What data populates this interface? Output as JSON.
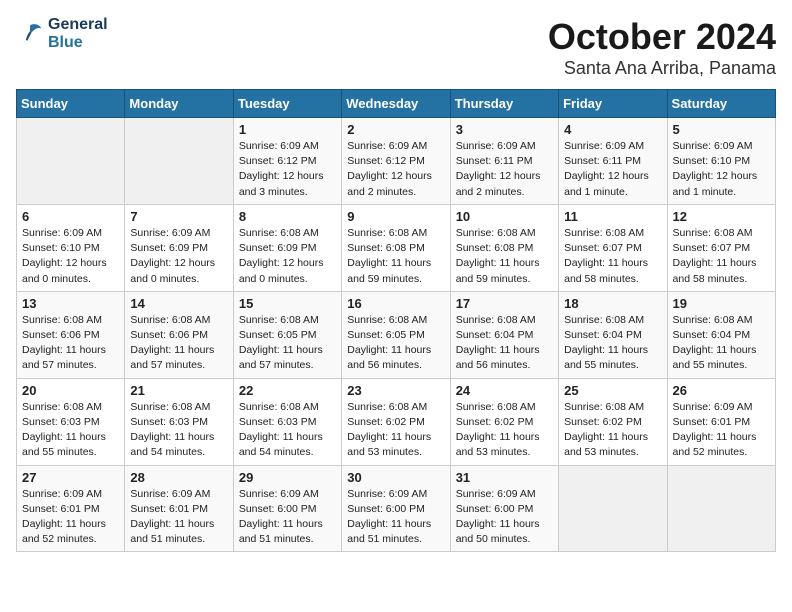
{
  "header": {
    "logo_line1": "General",
    "logo_line2": "Blue",
    "title": "October 2024",
    "subtitle": "Santa Ana Arriba, Panama"
  },
  "weekdays": [
    "Sunday",
    "Monday",
    "Tuesday",
    "Wednesday",
    "Thursday",
    "Friday",
    "Saturday"
  ],
  "weeks": [
    [
      {
        "day": "",
        "info": ""
      },
      {
        "day": "",
        "info": ""
      },
      {
        "day": "1",
        "info": "Sunrise: 6:09 AM\nSunset: 6:12 PM\nDaylight: 12 hours and 3 minutes."
      },
      {
        "day": "2",
        "info": "Sunrise: 6:09 AM\nSunset: 6:12 PM\nDaylight: 12 hours and 2 minutes."
      },
      {
        "day": "3",
        "info": "Sunrise: 6:09 AM\nSunset: 6:11 PM\nDaylight: 12 hours and 2 minutes."
      },
      {
        "day": "4",
        "info": "Sunrise: 6:09 AM\nSunset: 6:11 PM\nDaylight: 12 hours and 1 minute."
      },
      {
        "day": "5",
        "info": "Sunrise: 6:09 AM\nSunset: 6:10 PM\nDaylight: 12 hours and 1 minute."
      }
    ],
    [
      {
        "day": "6",
        "info": "Sunrise: 6:09 AM\nSunset: 6:10 PM\nDaylight: 12 hours and 0 minutes."
      },
      {
        "day": "7",
        "info": "Sunrise: 6:09 AM\nSunset: 6:09 PM\nDaylight: 12 hours and 0 minutes."
      },
      {
        "day": "8",
        "info": "Sunrise: 6:08 AM\nSunset: 6:09 PM\nDaylight: 12 hours and 0 minutes."
      },
      {
        "day": "9",
        "info": "Sunrise: 6:08 AM\nSunset: 6:08 PM\nDaylight: 11 hours and 59 minutes."
      },
      {
        "day": "10",
        "info": "Sunrise: 6:08 AM\nSunset: 6:08 PM\nDaylight: 11 hours and 59 minutes."
      },
      {
        "day": "11",
        "info": "Sunrise: 6:08 AM\nSunset: 6:07 PM\nDaylight: 11 hours and 58 minutes."
      },
      {
        "day": "12",
        "info": "Sunrise: 6:08 AM\nSunset: 6:07 PM\nDaylight: 11 hours and 58 minutes."
      }
    ],
    [
      {
        "day": "13",
        "info": "Sunrise: 6:08 AM\nSunset: 6:06 PM\nDaylight: 11 hours and 57 minutes."
      },
      {
        "day": "14",
        "info": "Sunrise: 6:08 AM\nSunset: 6:06 PM\nDaylight: 11 hours and 57 minutes."
      },
      {
        "day": "15",
        "info": "Sunrise: 6:08 AM\nSunset: 6:05 PM\nDaylight: 11 hours and 57 minutes."
      },
      {
        "day": "16",
        "info": "Sunrise: 6:08 AM\nSunset: 6:05 PM\nDaylight: 11 hours and 56 minutes."
      },
      {
        "day": "17",
        "info": "Sunrise: 6:08 AM\nSunset: 6:04 PM\nDaylight: 11 hours and 56 minutes."
      },
      {
        "day": "18",
        "info": "Sunrise: 6:08 AM\nSunset: 6:04 PM\nDaylight: 11 hours and 55 minutes."
      },
      {
        "day": "19",
        "info": "Sunrise: 6:08 AM\nSunset: 6:04 PM\nDaylight: 11 hours and 55 minutes."
      }
    ],
    [
      {
        "day": "20",
        "info": "Sunrise: 6:08 AM\nSunset: 6:03 PM\nDaylight: 11 hours and 55 minutes."
      },
      {
        "day": "21",
        "info": "Sunrise: 6:08 AM\nSunset: 6:03 PM\nDaylight: 11 hours and 54 minutes."
      },
      {
        "day": "22",
        "info": "Sunrise: 6:08 AM\nSunset: 6:03 PM\nDaylight: 11 hours and 54 minutes."
      },
      {
        "day": "23",
        "info": "Sunrise: 6:08 AM\nSunset: 6:02 PM\nDaylight: 11 hours and 53 minutes."
      },
      {
        "day": "24",
        "info": "Sunrise: 6:08 AM\nSunset: 6:02 PM\nDaylight: 11 hours and 53 minutes."
      },
      {
        "day": "25",
        "info": "Sunrise: 6:08 AM\nSunset: 6:02 PM\nDaylight: 11 hours and 53 minutes."
      },
      {
        "day": "26",
        "info": "Sunrise: 6:09 AM\nSunset: 6:01 PM\nDaylight: 11 hours and 52 minutes."
      }
    ],
    [
      {
        "day": "27",
        "info": "Sunrise: 6:09 AM\nSunset: 6:01 PM\nDaylight: 11 hours and 52 minutes."
      },
      {
        "day": "28",
        "info": "Sunrise: 6:09 AM\nSunset: 6:01 PM\nDaylight: 11 hours and 51 minutes."
      },
      {
        "day": "29",
        "info": "Sunrise: 6:09 AM\nSunset: 6:00 PM\nDaylight: 11 hours and 51 minutes."
      },
      {
        "day": "30",
        "info": "Sunrise: 6:09 AM\nSunset: 6:00 PM\nDaylight: 11 hours and 51 minutes."
      },
      {
        "day": "31",
        "info": "Sunrise: 6:09 AM\nSunset: 6:00 PM\nDaylight: 11 hours and 50 minutes."
      },
      {
        "day": "",
        "info": ""
      },
      {
        "day": "",
        "info": ""
      }
    ]
  ]
}
